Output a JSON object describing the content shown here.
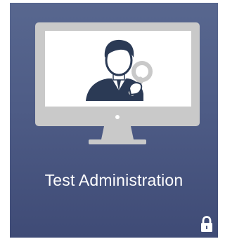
{
  "tile": {
    "title": "Test Administration",
    "graphic_icon": "monitor-with-user-and-key-icon",
    "status_icon": "lock-icon",
    "background_color": "#4e5c86",
    "screen_color": "#ffffff",
    "frame_color": "#c9c9c9"
  }
}
